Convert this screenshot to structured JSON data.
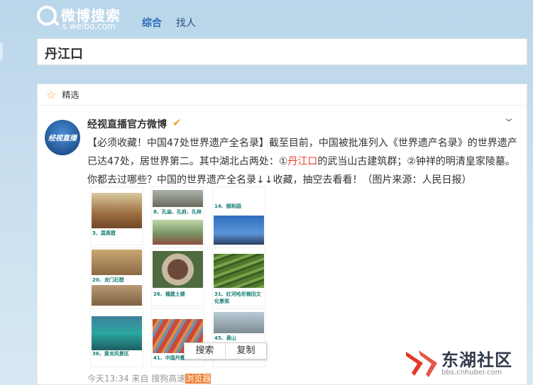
{
  "header": {
    "logo_title": "微博搜索",
    "logo_domain": "s.weibo.com",
    "tabs": [
      {
        "label": "综合",
        "active": true
      },
      {
        "label": "找人",
        "active": false
      }
    ]
  },
  "search": {
    "query": "丹江口"
  },
  "card": {
    "section_label": "精选",
    "author": "经视直播官方微博",
    "avatar_text": "经视直播",
    "content_parts": {
      "before": "【必须收藏！中国47处世界遗产全名录】截至目前，中国被批准列入《世界遗产名录》的世界遗产已达47处，居世界第二。其中湖北占两处：①",
      "highlight": "丹江口",
      "after": "的武当山古建筑群；②钟祥的明清皇家陵墓。你都去过哪些？中国的世界遗产全名录↓↓收藏，抽空去看看！（图片来源：人民日报）"
    },
    "images": [
      {
        "caption": "3、莫高窟"
      },
      {
        "caption": "8、孔庙、孔府、孔林"
      },
      {
        "caption": "14、颐和园"
      },
      {
        "caption": "20、龙门石窟"
      },
      {
        "caption": "26、福建土楼"
      },
      {
        "caption": "31、红河哈尼梯田文化景观"
      },
      {
        "caption": "36、黄龙风景区"
      },
      {
        "caption": "41、中国丹霞"
      },
      {
        "caption": "45、黄山"
      }
    ],
    "context_menu": [
      "搜索",
      "复制"
    ],
    "meta_prefix": "今天13:34 来自 搜狗高速",
    "meta_selected": "浏览器"
  },
  "watermark": {
    "title": "东湖社区",
    "domain": "bbs.cnhubei.com"
  },
  "colors": {
    "accent": "#2c6ab8",
    "highlight": "#e8412c",
    "verified": "#f3a021",
    "watermark_red": "#e03a2a"
  }
}
